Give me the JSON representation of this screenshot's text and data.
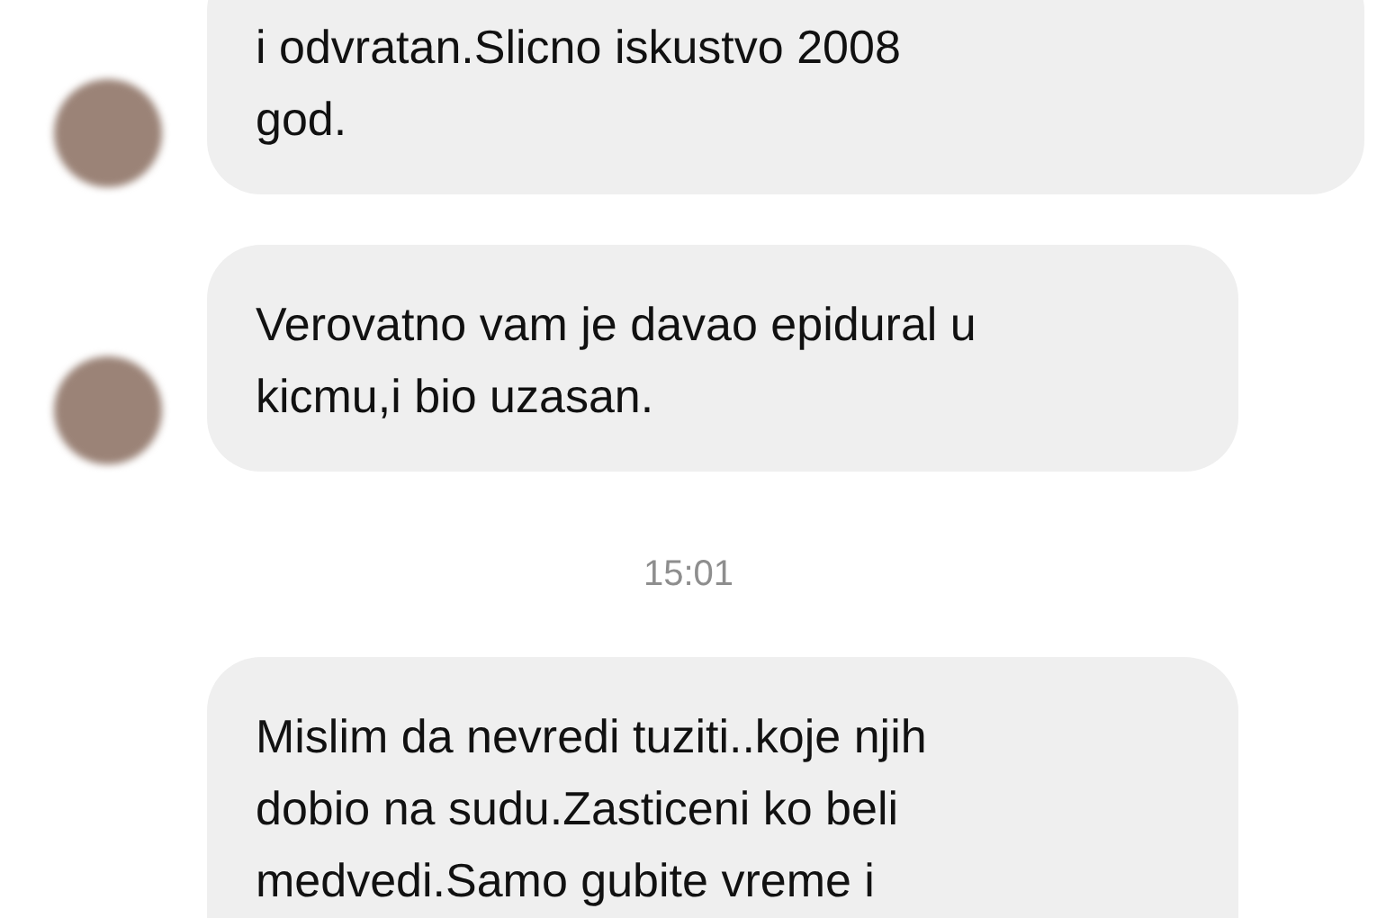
{
  "messages": [
    {
      "kind": "message",
      "avatar": true,
      "text": "i odvratan.Slicno iskustvo 2008\ngod."
    },
    {
      "kind": "message",
      "avatar": true,
      "text": "Verovatno vam je davao epidural u\nkicmu,i bio uzasan."
    },
    {
      "kind": "time",
      "text": "15:01"
    },
    {
      "kind": "message",
      "avatar": false,
      "text": "Mislim da nevredi tuziti..koje njih\ndobio na sudu.Zasticeni ko beli\nmedvedi.Samo gubite vreme i"
    }
  ]
}
